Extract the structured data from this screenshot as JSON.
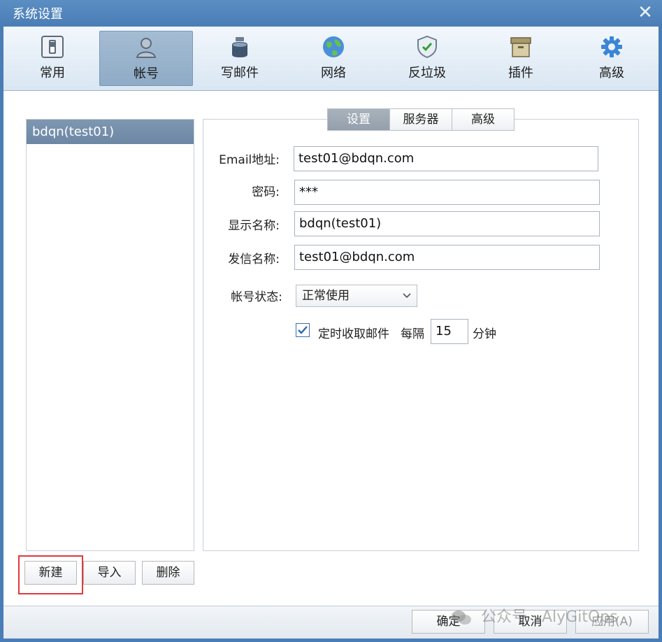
{
  "window": {
    "title": "系统设置",
    "close": "✕"
  },
  "toolbar": {
    "items": [
      {
        "label": "常用",
        "icon": "switch-icon"
      },
      {
        "label": "帐号",
        "icon": "user-icon"
      },
      {
        "label": "写邮件",
        "icon": "inkwell-icon"
      },
      {
        "label": "网络",
        "icon": "globe-icon"
      },
      {
        "label": "反垃圾",
        "icon": "shield-icon"
      },
      {
        "label": "插件",
        "icon": "box-icon"
      },
      {
        "label": "高级",
        "icon": "gear-icon"
      }
    ],
    "active": "帐号"
  },
  "accounts": {
    "items": [
      "bdqn(test01)"
    ]
  },
  "left_buttons": {
    "new": "新建",
    "import": "导入",
    "delete": "删除"
  },
  "tabs": {
    "items": [
      "设置",
      "服务器",
      "高级"
    ],
    "active": "设置"
  },
  "form": {
    "email_label": "Email地址:",
    "email_value": "test01@bdqn.com",
    "password_label": "密码:",
    "password_value": "***",
    "display_name_label": "显示名称:",
    "display_name_value": "bdqn(test01)",
    "sender_name_label": "发信名称:",
    "sender_name_value": "test01@bdqn.com",
    "status_label": "帐号状态:",
    "status_value": "正常使用",
    "timer_label": "定时收取邮件",
    "timer_checked": true,
    "interval_prefix": "每隔",
    "interval_value": "15",
    "interval_suffix": "分钟"
  },
  "footer": {
    "ok": "确定",
    "cancel": "取消",
    "apply": "应用(A)"
  },
  "watermark": "公众号 · AlyGitOps",
  "colors": {
    "titlebar": "#4a7db6",
    "selected": "#6c87a4",
    "highlight": "#e0393e"
  }
}
